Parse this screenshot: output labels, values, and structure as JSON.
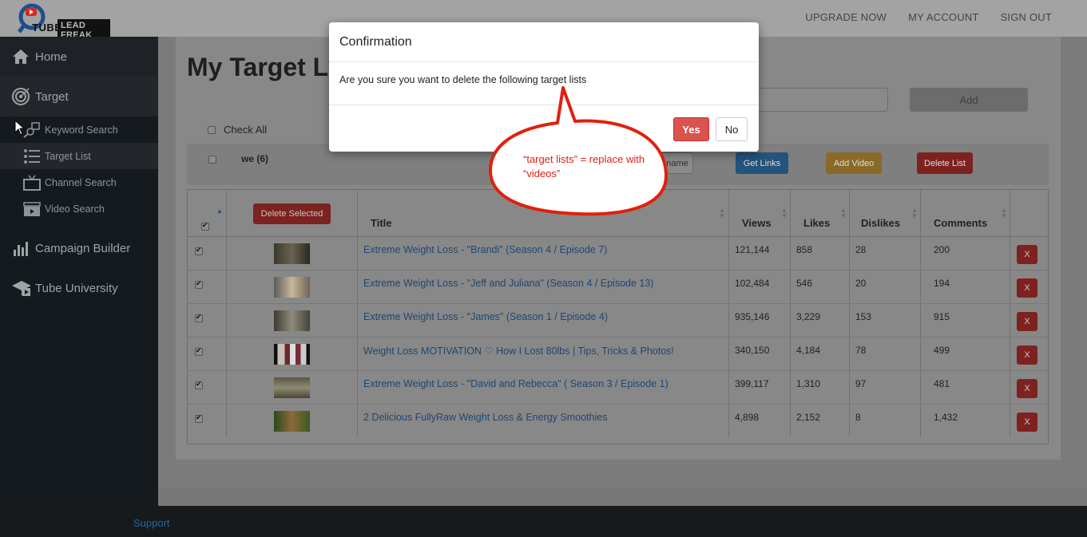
{
  "app": {
    "logo_tube": "TUBE",
    "logo_brand": "LEAD FREAK"
  },
  "topnav": [
    "UPGRADE NOW",
    "MY ACCOUNT",
    "SIGN OUT"
  ],
  "sidebar": {
    "home": "Home",
    "target": "Target",
    "sub": [
      "Keyword Search",
      "Target List",
      "Channel Search",
      "Video Search"
    ],
    "campaign": "Campaign Builder",
    "university": "Tube University"
  },
  "page": {
    "title": "My Target Lists",
    "add_label": "Add",
    "check_all": "Check All"
  },
  "list": {
    "name": "we (6)",
    "rename": "Rename",
    "get_links": "Get Links",
    "add_video": "Add Video",
    "delete_list": "Delete List"
  },
  "table": {
    "delete_selected": "Delete Selected",
    "headers": {
      "title": "Title",
      "views": "Views",
      "likes": "Likes",
      "dislikes": "Dislikes",
      "comments": "Comments"
    },
    "rows": [
      {
        "title": "Extreme Weight Loss - \"Brandi\" (Season 4 / Episode 7)",
        "views": "121,144",
        "likes": "858",
        "dislikes": "28",
        "comments": "200"
      },
      {
        "title": "Extreme Weight Loss - \"Jeff and Juliana\" (Season 4 / Episode 13)",
        "views": "102,484",
        "likes": "546",
        "dislikes": "20",
        "comments": "194"
      },
      {
        "title": "Extreme Weight Loss - \"James\" (Season 1 / Episode 4)",
        "views": "935,146",
        "likes": "3,229",
        "dislikes": "153",
        "comments": "915"
      },
      {
        "title": "Weight Loss MOTIVATION ♡ How I Lost 80lbs | Tips, Tricks & Photos!",
        "views": "340,150",
        "likes": "4,184",
        "dislikes": "78",
        "comments": "499"
      },
      {
        "title": "Extreme Weight Loss - \"David and Rebecca\" ( Season 3 / Episode 1)",
        "views": "399,117",
        "likes": "1,310",
        "dislikes": "97",
        "comments": "481"
      },
      {
        "title": "2 Delicious FullyRaw Weight Loss & Energy Smoothies",
        "views": "4,898",
        "likes": "2,152",
        "dislikes": "8",
        "comments": "1,432"
      }
    ],
    "remove_label": "X"
  },
  "footer": {
    "support": "Support"
  },
  "modal": {
    "title": "Confirmation",
    "message": "Are you sure you want to delete the following target lists",
    "yes": "Yes",
    "no": "No"
  },
  "callout": {
    "text": "“target lists” = replace with “videos”"
  },
  "colors": {
    "danger": "#d9534f",
    "link": "#2a64a5",
    "callout": "#e02010"
  }
}
